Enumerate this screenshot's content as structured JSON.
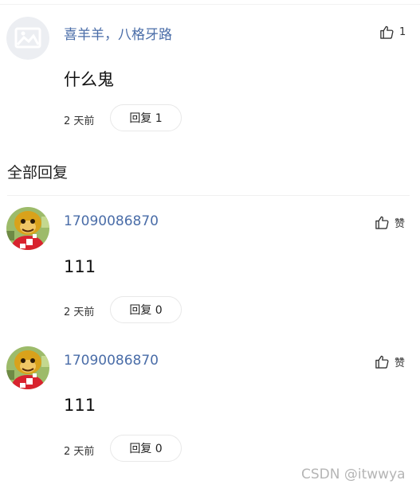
{
  "main_comment": {
    "username": "喜羊羊，八格牙路",
    "content": "什么鬼",
    "time": "2 天前",
    "reply_label": "回复 1",
    "like_count": "1",
    "avatar_icon": "image-placeholder-icon"
  },
  "section": {
    "title": "全部回复"
  },
  "replies": [
    {
      "username": "17090086870",
      "content": "111",
      "time": "2 天前",
      "reply_label": "回复 0",
      "like_label": "赞",
      "avatar_icon": "monkey-avatar-icon"
    },
    {
      "username": "17090086870",
      "content": "111",
      "time": "2 天前",
      "reply_label": "回复 0",
      "like_label": "赞",
      "avatar_icon": "monkey-avatar-icon"
    }
  ],
  "watermark": "CSDN @itwwya",
  "colors": {
    "username": "#4a6da8",
    "border": "#e8e8e8",
    "watermark": "#b5b5b5"
  }
}
